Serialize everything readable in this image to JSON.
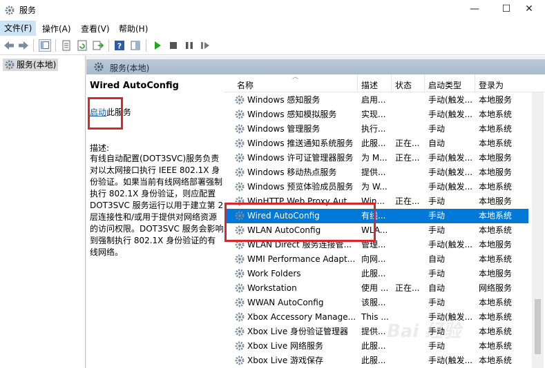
{
  "window": {
    "title": "服务",
    "minimize": "—",
    "maximize": "☐",
    "close": "✕"
  },
  "menu": {
    "items": [
      "文件(F)",
      "操作(A)",
      "查看(V)",
      "帮助(H)"
    ]
  },
  "tree": {
    "node_label": "服务(本地)"
  },
  "panel": {
    "header_title": "服务(本地)",
    "service_title": "Wired AutoConfig",
    "start_link": "启动",
    "start_suffix": "此服务",
    "desc_label": "描述:",
    "desc_text": "有线自动配置(DOT3SVC)服务负责对以太网接口执行 IEEE 802.1X 身份验证。如果当前有线网络部署强制执行 802.1X 身份验证，则应配置 DOT3SVC 服务运行以用于建立第 2 层连接性和/或用于提供对网络资源的访问权限。DOT3SVC 服务会影响到强制执行 802.1X 身份验证的有线网络。"
  },
  "columns": {
    "name": "名称",
    "desc": "描述",
    "status": "状态",
    "startup": "启动类型",
    "logon": "登录为"
  },
  "rows": [
    {
      "name": "Windows 感知服务",
      "desc": "启用...",
      "status": "",
      "startup": "手动(触发...",
      "logon": "本地服务"
    },
    {
      "name": "Windows 感知模拟服务",
      "desc": "实现...",
      "status": "",
      "startup": "手动(触发...",
      "logon": "本地系统"
    },
    {
      "name": "Windows 管理服务",
      "desc": "执行...",
      "status": "",
      "startup": "手动",
      "logon": "本地系统"
    },
    {
      "name": "Windows 推送通知系统服务",
      "desc": "此服...",
      "status": "正在...",
      "startup": "自动",
      "logon": "本地系统"
    },
    {
      "name": "Windows 许可证管理器服务",
      "desc": "为 M...",
      "status": "正在...",
      "startup": "手动(触发...",
      "logon": "本地服务"
    },
    {
      "name": "Windows 移动热点服务",
      "desc": "提供...",
      "status": "",
      "startup": "手动(触发...",
      "logon": "本地服务"
    },
    {
      "name": "Windows 预览体验成员服务",
      "desc": "为 W...",
      "status": "",
      "startup": "手动(触发...",
      "logon": "本地系统"
    },
    {
      "name": "WinHTTP Web Proxy Aut...",
      "desc": "Win...",
      "status": "正在...",
      "startup": "手动",
      "logon": "本地服务"
    },
    {
      "name": "Wired AutoConfig",
      "desc": "有线...",
      "status": "",
      "startup": "手动",
      "logon": "本地系统"
    },
    {
      "name": "WLAN AutoConfig",
      "desc": "WLA...",
      "status": "",
      "startup": "手动",
      "logon": "本地系统"
    },
    {
      "name": "WLAN Direct 服务连接管...",
      "desc": "管理...",
      "status": "",
      "startup": "手动(触发...",
      "logon": "本地服务"
    },
    {
      "name": "WMI Performance Adapt...",
      "desc": "向网...",
      "status": "",
      "startup": "自动",
      "logon": "本地系统"
    },
    {
      "name": "Work Folders",
      "desc": "此服...",
      "status": "",
      "startup": "手动",
      "logon": "本地服务"
    },
    {
      "name": "Workstation",
      "desc": "使用 ...",
      "status": "正在...",
      "startup": "自动",
      "logon": "网络服务"
    },
    {
      "name": "WWAN AutoConfig",
      "desc": "该服...",
      "status": "",
      "startup": "手动",
      "logon": "本地系统"
    },
    {
      "name": "Xbox Accessory Manage...",
      "desc": "This ...",
      "status": "",
      "startup": "手动(触发...",
      "logon": "本地系统"
    },
    {
      "name": "Xbox Live 身份验证管理器",
      "desc": "提供...",
      "status": "",
      "startup": "手动",
      "logon": "本地系统"
    },
    {
      "name": "Xbox Live 网络服务",
      "desc": "此服...",
      "status": "",
      "startup": "手动",
      "logon": "本地系统"
    },
    {
      "name": "Xbox Live 游戏保存",
      "desc": "此服...",
      "status": "",
      "startup": "手动(触发...",
      "logon": "本地系统"
    }
  ],
  "selected_row": 8,
  "watermark": "Bai 经验",
  "colors": {
    "selection": "#0078d7",
    "highlight_box": "#d9262a",
    "link": "#0f5eb3"
  }
}
